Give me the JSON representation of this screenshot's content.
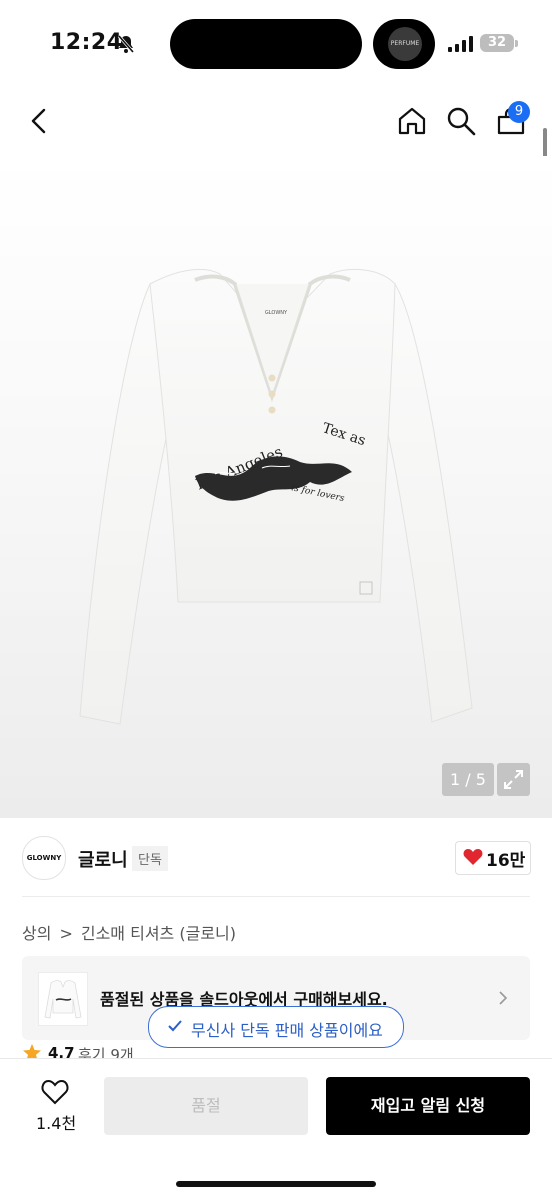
{
  "status": {
    "time": "12:24",
    "battery": "32",
    "island_thumb_text": "PERFUME"
  },
  "nav": {
    "cart_count": "9"
  },
  "image": {
    "counter": "1 / 5",
    "brand_label": "GLOWNY",
    "print_left": "Los Angeles",
    "print_right": "Tex as",
    "print_sub": "is for lovers"
  },
  "brand": {
    "logo_text": "GLOWNY",
    "name": "글로니",
    "tag": "단독",
    "likes": "16만"
  },
  "breadcrumb": {
    "items": [
      "상의",
      "긴소매 티셔츠 (글로니)"
    ],
    "separator": ">"
  },
  "soldout": {
    "text": "품절된 상품을 솔드아웃에서 구매해보세요."
  },
  "exclusive": {
    "text": "무신사 단독 판매 상품이에요"
  },
  "rating": {
    "value": "4.7",
    "label": "후기 9개"
  },
  "bottom": {
    "wish_count": "1.4천",
    "soldout_label": "품절",
    "restock_label": "재입고 알림 신청"
  },
  "colors": {
    "accent": "#1b6ef3",
    "heart": "#e0262f",
    "pill": "#3b6fd8"
  }
}
